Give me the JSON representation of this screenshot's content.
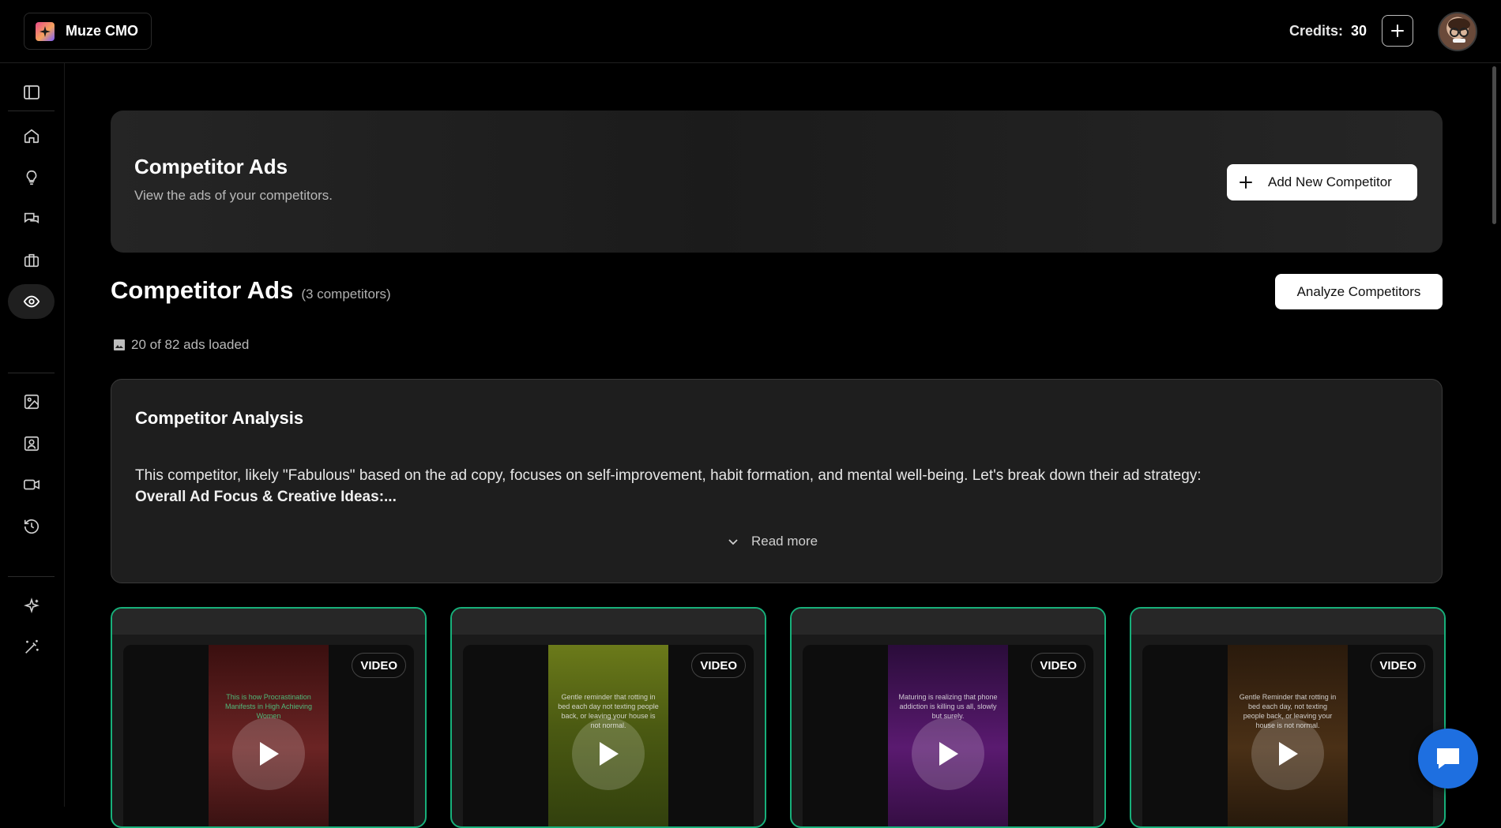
{
  "app": {
    "name": "Muze CMO"
  },
  "topbar": {
    "credits_label": "Credits:",
    "credits_value": "30"
  },
  "sidebar": {
    "items": [
      {
        "icon": "sidebar-toggle-icon"
      },
      {
        "icon": "home-icon"
      },
      {
        "icon": "lightbulb-icon"
      },
      {
        "icon": "chat-icon"
      },
      {
        "icon": "briefcase-icon"
      },
      {
        "icon": "eye-icon",
        "active": true
      },
      {
        "icon": "image-icon"
      },
      {
        "icon": "user-portrait-icon"
      },
      {
        "icon": "video-icon"
      },
      {
        "icon": "history-icon"
      },
      {
        "icon": "sparkle-icon"
      },
      {
        "icon": "magic-wand-icon"
      }
    ]
  },
  "header_card": {
    "title": "Competitor Ads",
    "subtitle": "View the ads of your competitors.",
    "add_button": "Add New Competitor"
  },
  "section": {
    "title": "Competitor Ads",
    "count": "(3 competitors)",
    "analyze_button": "Analyze Competitors",
    "loaded_text": "20 of 82 ads loaded"
  },
  "analysis": {
    "title": "Competitor Analysis",
    "body": "This competitor, likely \"Fabulous\" based on the ad copy, focuses on self-improvement, habit formation, and mental well-being. Let's break down their ad strategy:",
    "bold_line": "Overall Ad Focus & Creative Ideas:...",
    "read_more": "Read more"
  },
  "ads": [
    {
      "badge": "VIDEO",
      "thumb_text": "This is how Procrastination Manifests in High Achieving Women",
      "color": "#5a1d1d"
    },
    {
      "badge": "VIDEO",
      "thumb_text": "Gentle reminder that rotting in bed each day not texting people back, or leaving your house is not normal.",
      "color": "#4b5a12"
    },
    {
      "badge": "VIDEO",
      "thumb_text": "Maturing is realizing that phone addiction is killing us all, slowly but surely.",
      "color": "#3d1450"
    },
    {
      "badge": "VIDEO",
      "thumb_text": "Gentle Reminder that rotting in bed each day, not texting people back, or leaving your house is not normal.",
      "color": "#3a2510"
    }
  ],
  "colors": {
    "accent_green": "#17b07a",
    "chat_blue": "#1e6fe0"
  }
}
